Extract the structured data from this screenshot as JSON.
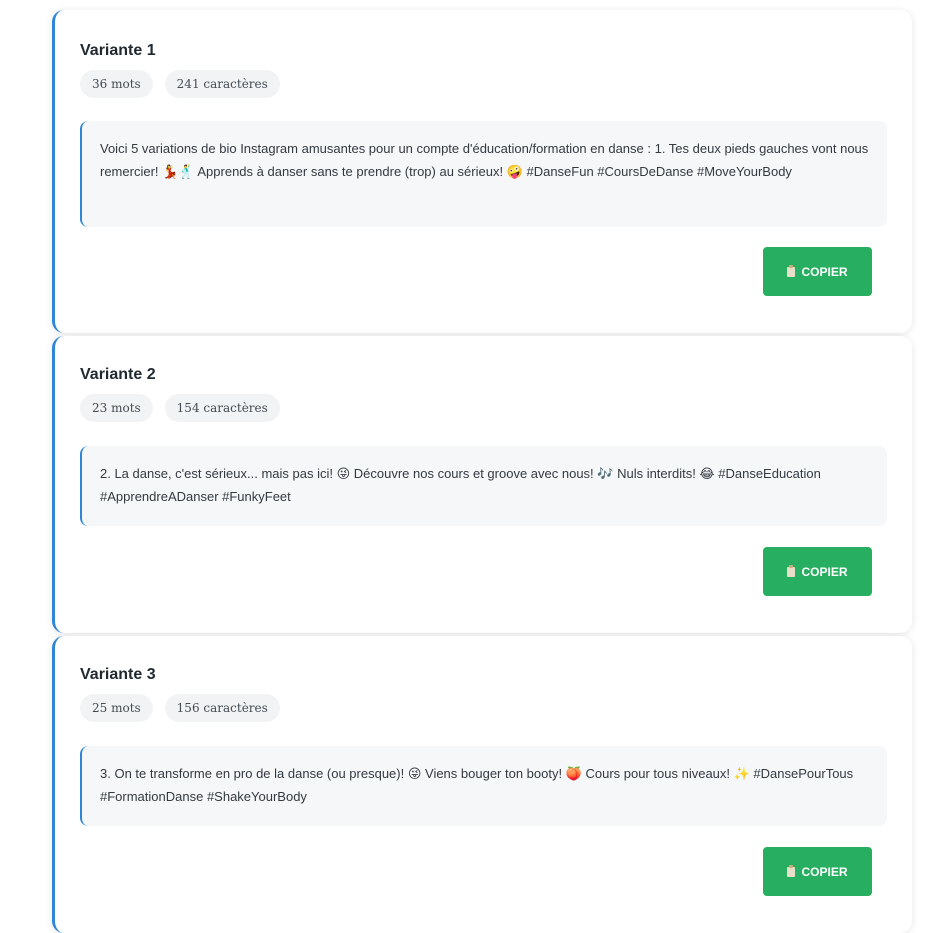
{
  "variants": [
    {
      "title": "Variante 1",
      "words": "36 mots",
      "chars": "241 caractères",
      "text": "Voici 5 variations de bio Instagram amusantes pour un compte d'éducation/formation en danse : 1. Tes deux pieds gauches vont nous remercier! 💃🕺 Apprends à danser sans te prendre (trop) au sérieux! 🤪 #DanseFun #CoursDeDanse #MoveYourBody",
      "button": "COPIER"
    },
    {
      "title": "Variante 2",
      "words": "23 mots",
      "chars": "154 caractères",
      "text": "2. La danse, c'est sérieux... mais pas ici! 😜 Découvre nos cours et groove avec nous! 🎶 Nuls interdits! 😂 #DanseEducation #ApprendreADanser #FunkyFeet",
      "button": "COPIER"
    },
    {
      "title": "Variante 3",
      "words": "25 mots",
      "chars": "156 caractères",
      "text": "3. On te transforme en pro de la danse (ou presque)! 😜 Viens bouger ton booty! 🍑 Cours pour tous niveaux! ✨ #DansePourTous #FormationDanse #ShakeYourBody",
      "button": "COPIER"
    }
  ],
  "colors": {
    "accent": "#2f86d6",
    "button": "#27ae60"
  },
  "icons": {
    "copy": "clipboard-icon"
  }
}
